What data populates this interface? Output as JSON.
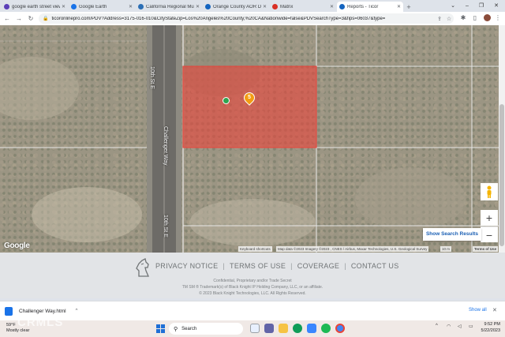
{
  "browser": {
    "tabs": [
      {
        "label": "google earth street view",
        "favicon_color": "#5b3fb8",
        "active": false
      },
      {
        "label": "Google Earth",
        "favicon_color": "#1a73e8",
        "active": false
      },
      {
        "label": "California Regional Multi",
        "favicon_color": "#2c6fb5",
        "active": false
      },
      {
        "label": "Orange County AOR Da",
        "favicon_color": "#1565c0",
        "active": false
      },
      {
        "label": "Matrix",
        "favicon_color": "#d93025",
        "active": false
      },
      {
        "label": "Reports - Ticor",
        "favicon_color": "#1565c0",
        "active": true
      }
    ],
    "new_tab": "+",
    "address": {
      "lock_icon": "lock-icon",
      "url": "ticoronlinepro.com/PDV?Address=3175-016-010&CityStateZip=Los%20Angeles%20County,%20CA&Nationwide=false&PDVSearchType=3&fips=06037&type="
    }
  },
  "map": {
    "street_labels": [
      "10th St E",
      "Challenger Way",
      "10th St E"
    ],
    "marker_label": "5",
    "marker_color": "#f39c12",
    "dot_color": "#2ea44f",
    "parcel_color": "#e8453c",
    "zoom_in": "+",
    "zoom_out": "−",
    "show_results": "Show Search Results",
    "google_logo": "Google",
    "attribution": {
      "shortcuts": "Keyboard shortcuts",
      "map_data": "Map data ©2023 Imagery ©2023 , CNES / Airbus, Maxar Technologies, U.S. Geological Survey",
      "scale": "10 m",
      "terms": "Terms of Use"
    }
  },
  "footer": {
    "links": [
      "PRIVACY NOTICE",
      "TERMS OF USE",
      "COVERAGE",
      "CONTACT US"
    ],
    "separator": "|",
    "legal": [
      "Confidential, Proprietary and/or Trade Secret",
      "TM SM ® Trademark(s) of Black Knight IP Holding Company, LLC, or an affiliate.",
      "© 2023 Black Knight Technologies, LLC. All Rights Reserved."
    ]
  },
  "downloads": {
    "filename": "Challenger Way.html",
    "show_all": "Show all",
    "close": "✕"
  },
  "taskbar": {
    "weather_temp": "59°F",
    "weather_desc": "Mostly clear",
    "watermark": "CRMLS",
    "search_placeholder": "Search",
    "time": "9:52 PM",
    "date": "5/22/2023"
  }
}
